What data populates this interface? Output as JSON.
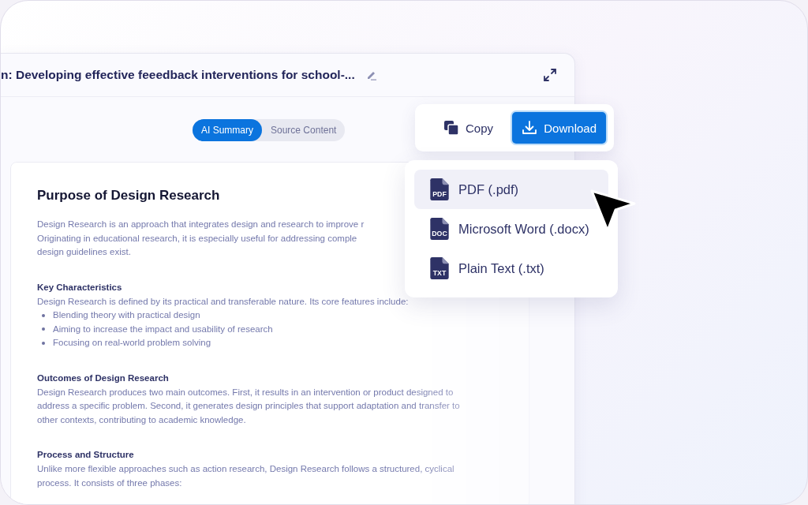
{
  "window": {
    "title": "n: Developing effective feeedback interventions for school-..."
  },
  "view_toggle": [
    {
      "label": "AI Summary",
      "selected": true
    },
    {
      "label": "Source Content",
      "selected": false
    }
  ],
  "document": {
    "heading": "Purpose of Design Research",
    "sections": [
      {
        "kind": "intro",
        "lines": [
          "Design Research is an approach that integrates design and research to improve r",
          "Originating in educational research, it is especially useful for addressing comple",
          "design guidelines exist."
        ]
      },
      {
        "kind": "section",
        "title": "Key Characteristics",
        "lines": [
          "Design Research is defined by its practical and transferable nature. Its core features include:"
        ],
        "bullets": [
          "Blending theory with practical design",
          "Aiming to increase the impact and usability of research",
          "Focusing on real-world problem solving"
        ]
      },
      {
        "kind": "section",
        "title": "Outcomes of Design Research",
        "lines": [
          "Design Research produces two main outcomes. First, it results in an intervention or product designed to",
          "address a specific problem. Second, it generates design principles that support adaptation and transfer to",
          "other contexts, contributing to academic knowledge."
        ]
      },
      {
        "kind": "section",
        "title": "Process and Structure",
        "lines": [
          "Unlike more flexible approaches such as action research, Design Research follows a structured, cyclical",
          "process. It consists of three phases:"
        ]
      }
    ]
  },
  "actions": [
    {
      "label": "Copy",
      "kind": "copy",
      "primary": false
    },
    {
      "label": "Download",
      "kind": "download",
      "primary": true
    }
  ],
  "download_menu": [
    {
      "label": "PDF (.pdf)",
      "badge": "PDF",
      "selected": true
    },
    {
      "label": "Microsoft Word (.docx)",
      "badge": "DOC",
      "selected": false
    },
    {
      "label": "Plain Text (.txt)",
      "badge": "TXT",
      "selected": false
    }
  ]
}
